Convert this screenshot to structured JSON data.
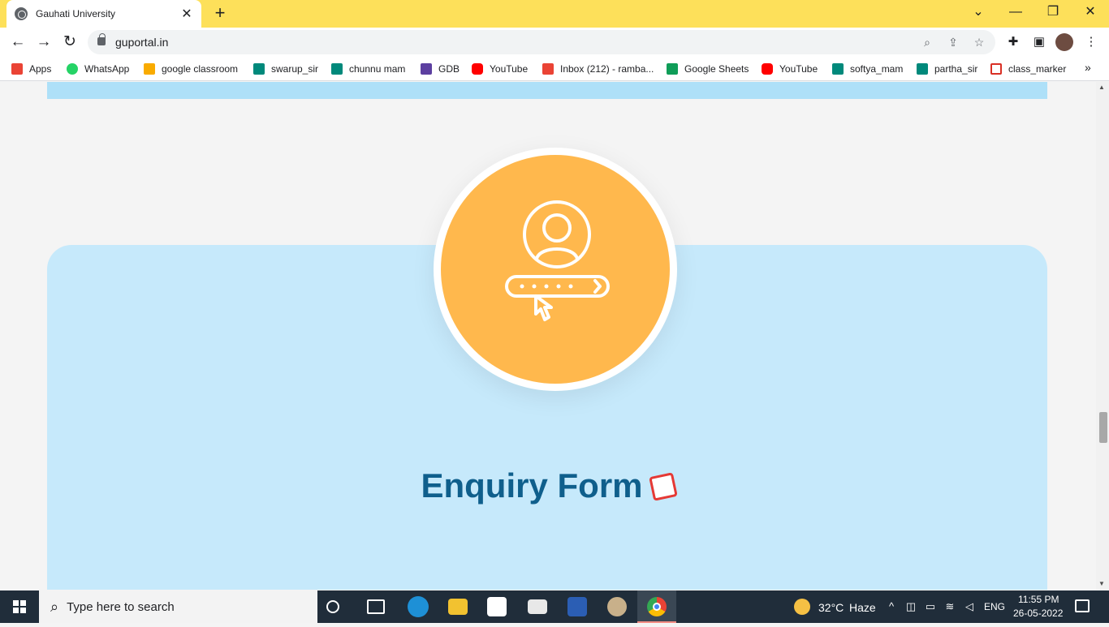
{
  "browser": {
    "tab_title": "Gauhati University",
    "url": "guportal.in",
    "new_tab": "+",
    "close_tab": "✕"
  },
  "bookmarks": [
    {
      "label": "Apps",
      "icon": "apps-grid-icon",
      "color": "#ea4335"
    },
    {
      "label": "WhatsApp",
      "icon": "whatsapp-icon",
      "color": "#25d366"
    },
    {
      "label": "google classroom",
      "icon": "classroom-icon",
      "color": "#f9ab00"
    },
    {
      "label": "swarup_sir",
      "icon": "meet-icon",
      "color": "#00897b"
    },
    {
      "label": "chunnu mam",
      "icon": "meet-icon",
      "color": "#00897b"
    },
    {
      "label": "GDB",
      "icon": "gdb-icon",
      "color": "#5c3fa0"
    },
    {
      "label": "YouTube",
      "icon": "youtube-icon",
      "color": "#ff0000"
    },
    {
      "label": "Inbox (212) - ramba...",
      "icon": "gmail-icon",
      "color": "#ea4335"
    },
    {
      "label": "Google Sheets",
      "icon": "sheets-icon",
      "color": "#0f9d58"
    },
    {
      "label": "YouTube",
      "icon": "youtube-icon",
      "color": "#ff0000"
    },
    {
      "label": "softya_mam",
      "icon": "meet-icon",
      "color": "#00897b"
    },
    {
      "label": "partha_sir",
      "icon": "meet-icon",
      "color": "#00897b"
    },
    {
      "label": "class_marker",
      "icon": "check-icon",
      "color": "#d93025"
    }
  ],
  "bookmarks_more": "»",
  "page": {
    "heading": "Enquiry Form",
    "accent_color": "#ffb84d",
    "card_color": "#c6e9fb",
    "heading_color": "#0f5f8c"
  },
  "taskbar": {
    "search_placeholder": "Type here to search",
    "weather_temp": "32°C",
    "weather_desc": "Haze",
    "language": "ENG",
    "time": "11:55 PM",
    "date": "26-05-2022"
  }
}
